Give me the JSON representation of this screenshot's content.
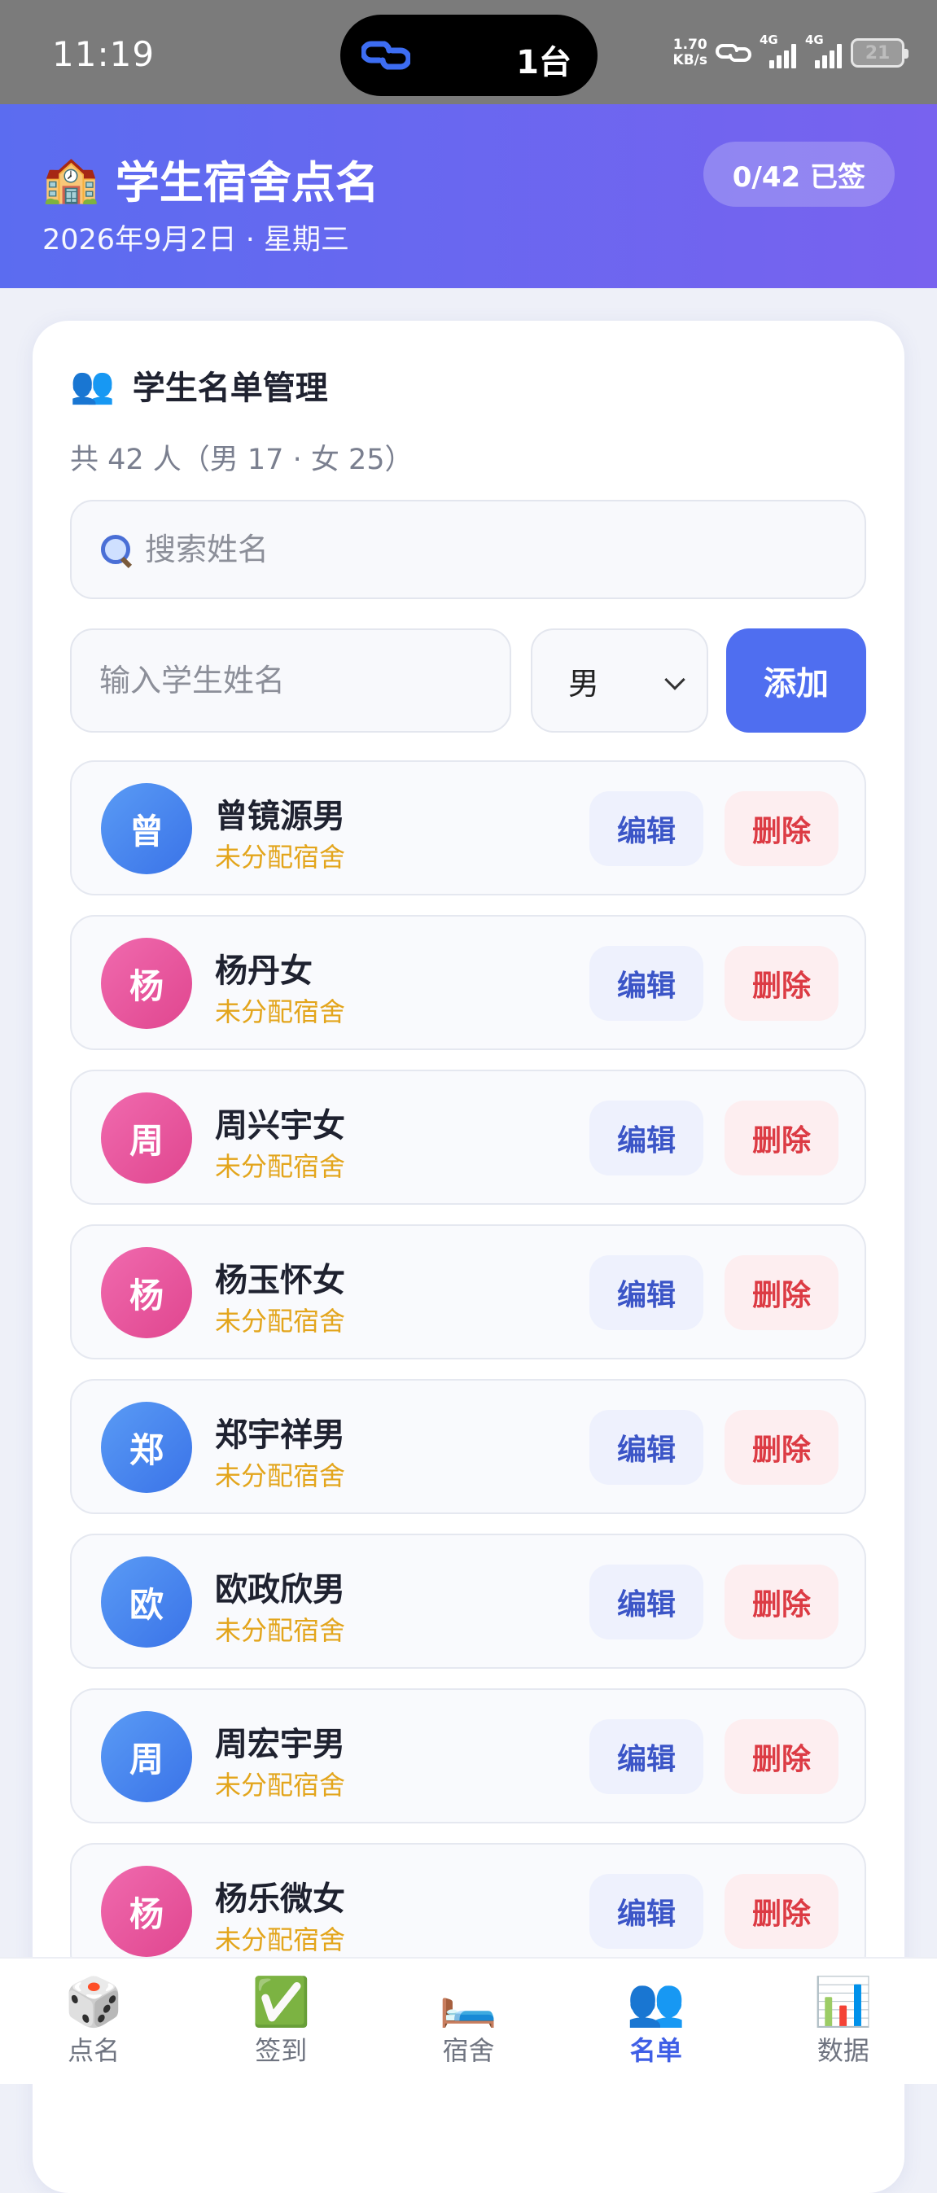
{
  "status_bar": {
    "time": "11:19",
    "island_text": "1台",
    "net_speed_value": "1.70",
    "net_speed_unit": "KB/s",
    "signal_label_1": "4G",
    "signal_label_2": "4G",
    "battery": "21"
  },
  "header": {
    "title": "学生宿舍点名",
    "date": "2026年9月2日 · 星期三",
    "sign_badge": "0/42 已签"
  },
  "roster": {
    "title": "学生名单管理",
    "count": "共 42 人（男 17 · 女 25）",
    "search_placeholder": "搜索姓名",
    "name_placeholder": "输入学生姓名",
    "gender_selected": "男",
    "add_label": "添加",
    "edit_label": "编辑",
    "delete_label": "删除",
    "students": [
      {
        "initial": "曾",
        "name": "曾镜源男",
        "status": "未分配宿舍",
        "gender": "male"
      },
      {
        "initial": "杨",
        "name": "杨丹女",
        "status": "未分配宿舍",
        "gender": "female"
      },
      {
        "initial": "周",
        "name": "周兴宇女",
        "status": "未分配宿舍",
        "gender": "female"
      },
      {
        "initial": "杨",
        "name": "杨玉怀女",
        "status": "未分配宿舍",
        "gender": "female"
      },
      {
        "initial": "郑",
        "name": "郑宇祥男",
        "status": "未分配宿舍",
        "gender": "male"
      },
      {
        "initial": "欧",
        "name": "欧政欣男",
        "status": "未分配宿舍",
        "gender": "male"
      },
      {
        "initial": "周",
        "name": "周宏宇男",
        "status": "未分配宿舍",
        "gender": "male"
      },
      {
        "initial": "杨",
        "name": "杨乐微女",
        "status": "未分配宿舍",
        "gender": "female"
      }
    ]
  },
  "bottom_nav": {
    "items": [
      {
        "label": "点名",
        "icon": "🎲",
        "icon_name": "dice-icon"
      },
      {
        "label": "签到",
        "icon": "✅",
        "icon_name": "check-icon"
      },
      {
        "label": "宿舍",
        "icon": "🛏️",
        "icon_name": "bed-icon"
      },
      {
        "label": "名单",
        "icon": "👥",
        "icon_name": "people-icon"
      },
      {
        "label": "数据",
        "icon": "📊",
        "icon_name": "chart-icon"
      }
    ],
    "active_index": 3
  },
  "colors": {
    "header_start": "#5b6cf0",
    "header_end": "#7862ef",
    "accent": "#4f6ef0",
    "male_avatar": "#3a73e8",
    "female_avatar": "#e0468f",
    "status_text": "#e3a51c",
    "delete_text": "#dc3b44"
  }
}
